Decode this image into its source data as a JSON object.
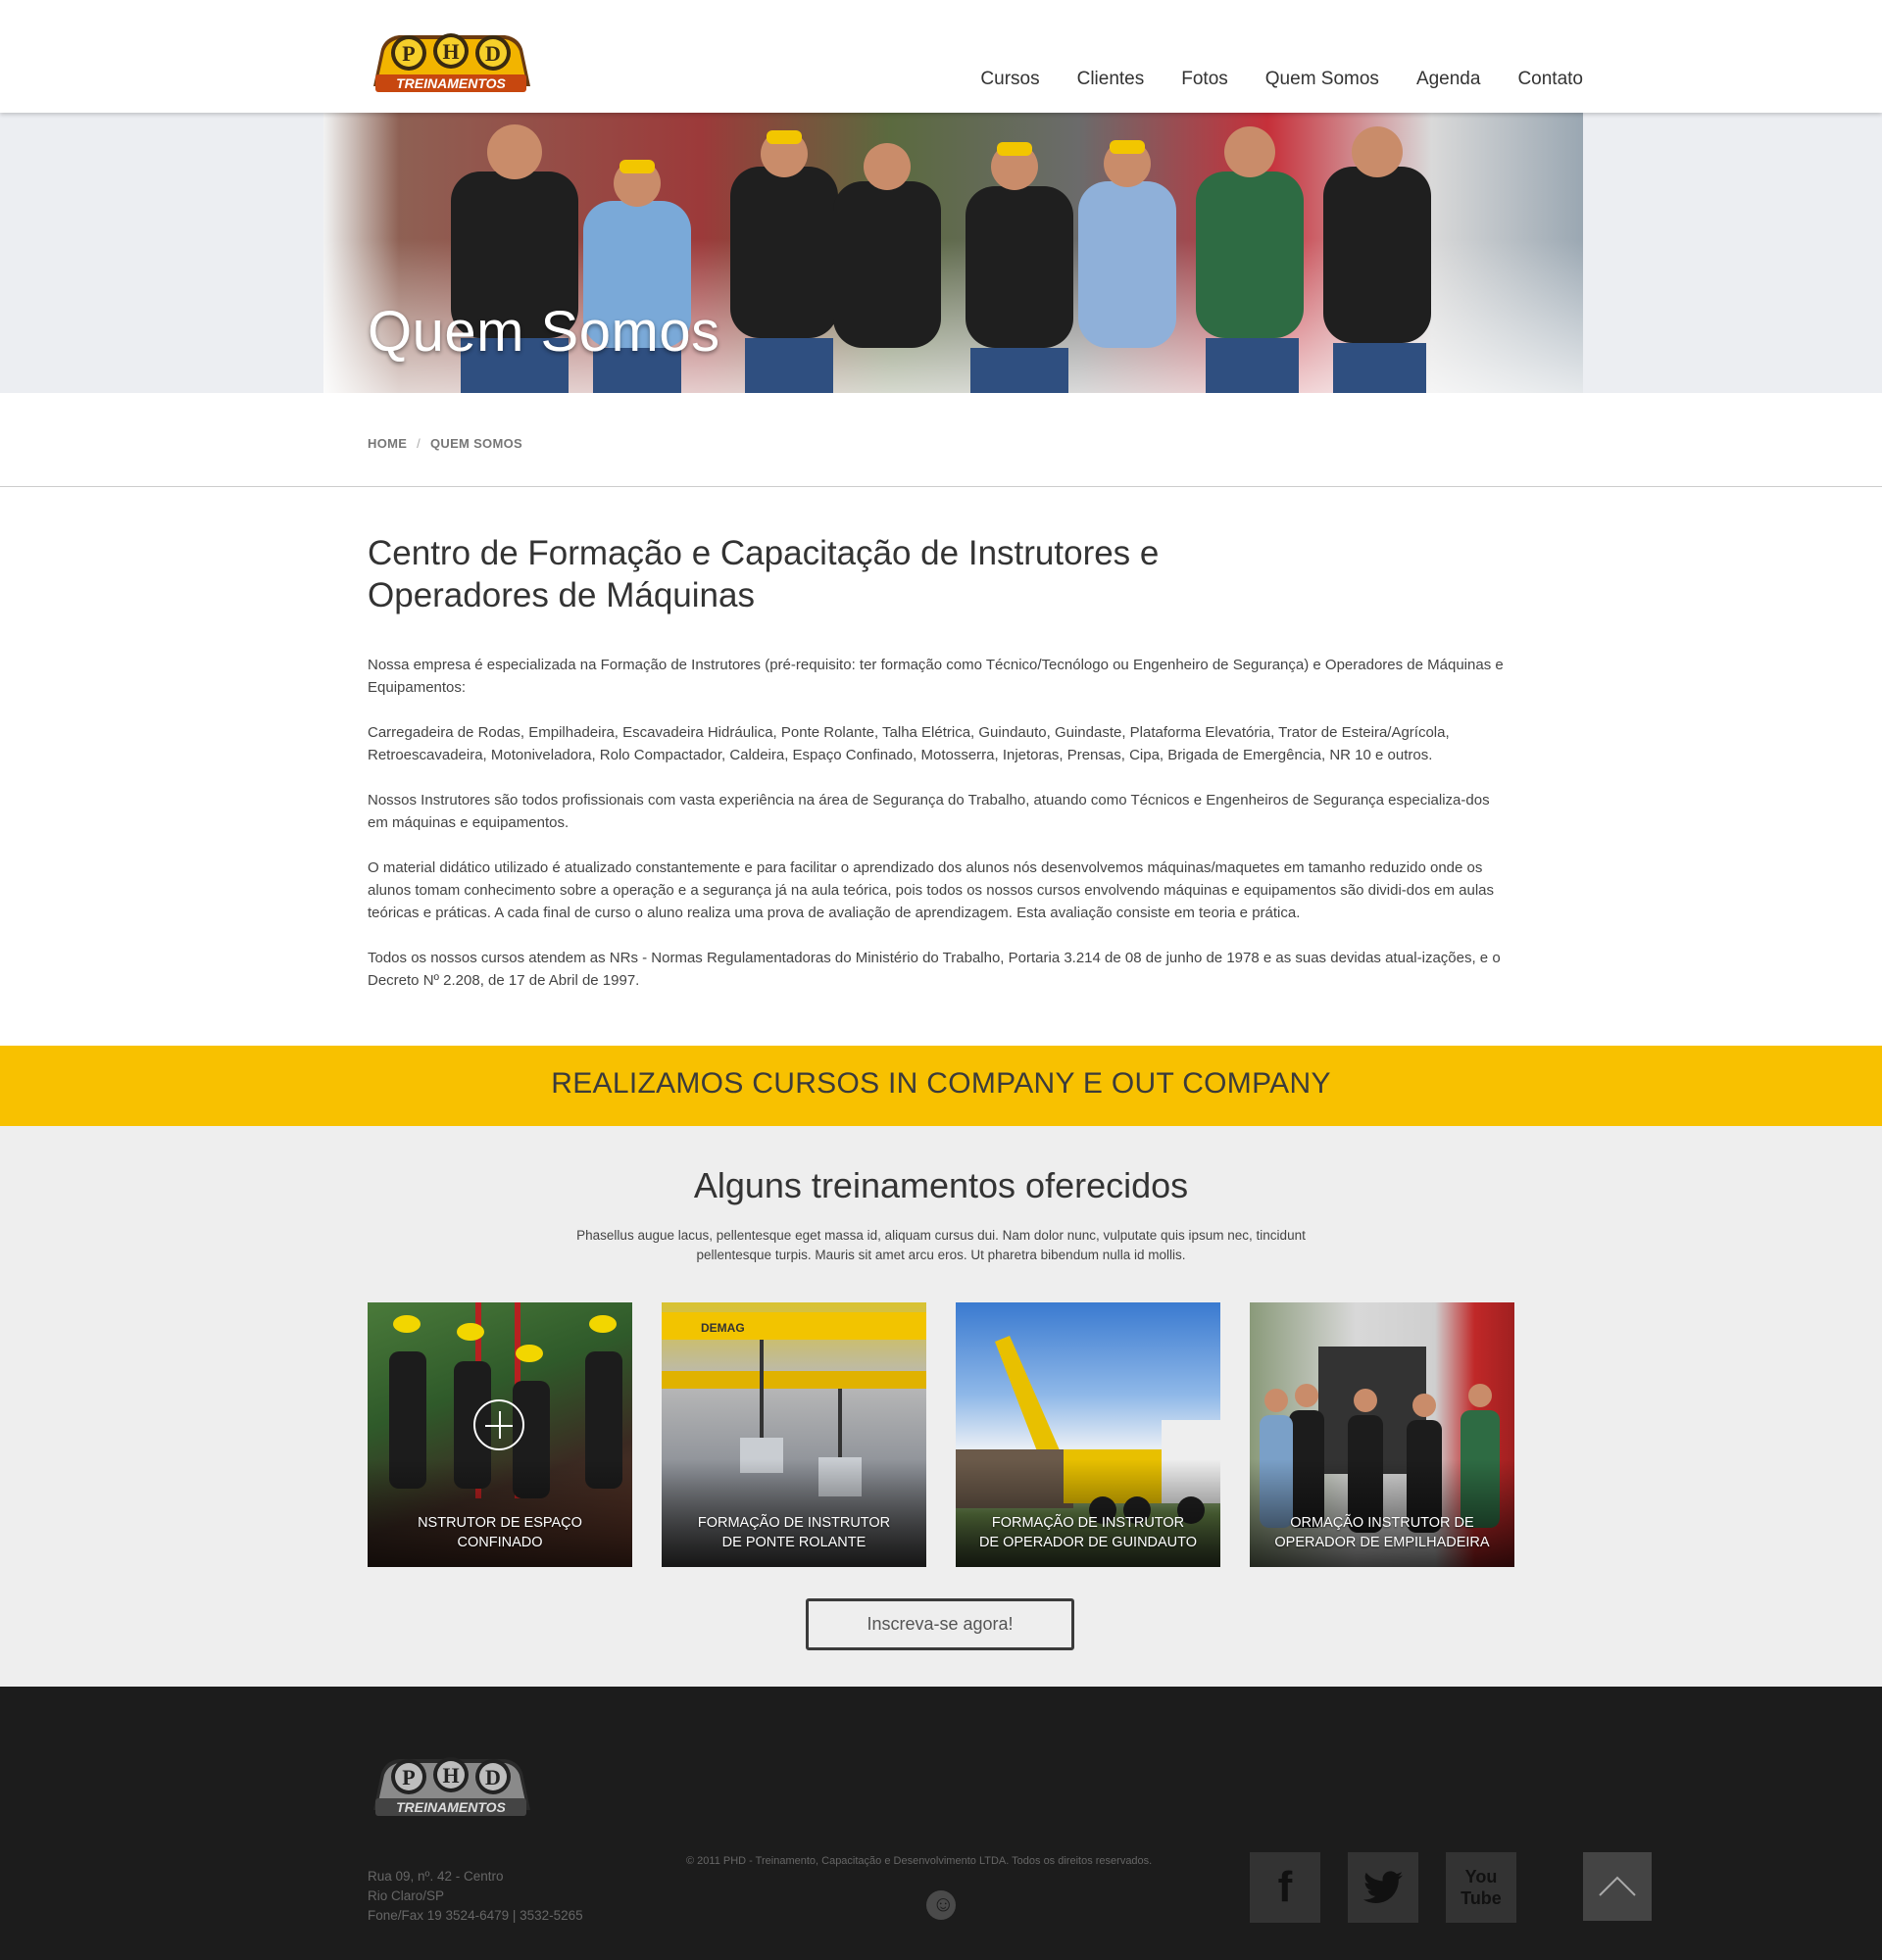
{
  "header": {
    "logo_alt": "PHD Treinamentos",
    "nav": [
      "Cursos",
      "Clientes",
      "Fotos",
      "Quem Somos",
      "Agenda",
      "Contato"
    ]
  },
  "hero": {
    "title": "Quem Somos"
  },
  "breadcrumb": {
    "home": "HOME",
    "separator": "/",
    "current": "QUEM SOMOS"
  },
  "content": {
    "heading": "Centro de Formação e Capacitação de Instrutores e Operadores de Máquinas",
    "paragraphs": [
      "Nossa empresa é especializada na Formação de Instrutores (pré-requisito: ter formação como Técnico/Tecnólogo ou Engenheiro de Segurança) e Operadores de Máquinas e Equipamentos:",
      "Carregadeira de Rodas, Empilhadeira, Escavadeira Hidráulica, Ponte Rolante, Talha Elétrica, Guindauto, Guindaste, Plataforma Elevatória, Trator de Esteira/Agrícola, Retroescavadeira, Motoniveladora, Rolo Compactador, Caldeira, Espaço Confinado, Motosserra, Injetoras, Prensas, Cipa, Brigada de Emergência, NR 10 e outros.",
      "Nossos Instrutores são todos profissionais com vasta experiência na área de Segurança do Trabalho, atuando como Técnicos e Engenheiros de Segurança especializa-dos em máquinas e equipamentos.",
      "O material didático utilizado é atualizado constantemente e para facilitar o aprendizado dos alunos nós desenvolvemos máquinas/maquetes em tamanho reduzido onde os alunos tomam conhecimento sobre a operação e a segurança já na aula teórica, pois todos os nossos cursos envolvendo máquinas e equipamentos são dividi-dos em aulas teóricas e práticas. A cada final de curso o aluno realiza uma prova de avaliação de aprendizagem. Esta avaliação consiste em teoria e prática.",
      "Todos os nossos cursos atendem as NRs - Normas Regulamentadoras do Ministério do Trabalho, Portaria 3.214 de 08 de junho de 1978 e as suas devidas atual-izações, e o Decreto Nº 2.208, de 17 de Abril de 1997."
    ]
  },
  "band": {
    "text": "REALIZAMOS CURSOS IN COMPANY E OUT COMPANY"
  },
  "trainings": {
    "title": "Alguns treinamentos oferecidos",
    "intro": "Phasellus augue lacus, pellentesque eget massa id, aliquam cursus dui. Nam dolor nunc, vulputate quis ipsum nec, tincidunt pellentesque turpis. Mauris sit amet arcu eros. Ut pharetra bibendum nulla id mollis.",
    "cards": [
      {
        "line1": "NSTRUTOR DE ESPAÇO",
        "line2": "CONFINADO"
      },
      {
        "line1": "FORMAÇÃO DE INSTRUTOR",
        "line2": "DE PONTE ROLANTE"
      },
      {
        "line1": "FORMAÇÃO DE INSTRUTOR",
        "line2": "DE OPERADOR DE GUINDAUTO"
      },
      {
        "line1": "ORMAÇÃO INSTRUTOR DE",
        "line2": "OPERADOR DE EMPILHADEIRA"
      }
    ],
    "button": "Inscreva-se agora!"
  },
  "footer": {
    "address": [
      "Rua 09, nº. 42 - Centro",
      "Rio Claro/SP",
      "Fone/Fax 19 3524-6479 | 3532-5265"
    ],
    "copyright": "© 2011 PHD - Treinamento, Capacitação e Desenvolvimento LTDA. Todos os direitos reservados.",
    "social": {
      "facebook": "f",
      "youtube_top": "You",
      "youtube_bottom": "Tube"
    },
    "icons": [
      "facebook-icon",
      "twitter-icon",
      "youtube-icon",
      "back-to-top-icon"
    ]
  },
  "colors": {
    "accent_yellow": "#f8c100",
    "footer_bg": "#1c1c1c",
    "card_highlight": "#f0a07d"
  }
}
